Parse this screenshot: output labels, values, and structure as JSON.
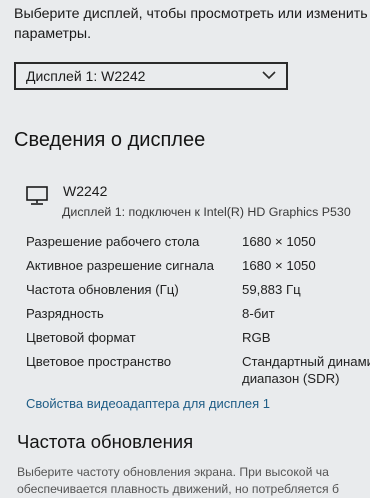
{
  "intro": {
    "line1": "Выберите дисплей, чтобы просмотреть или изменить е",
    "line2": "параметры."
  },
  "display_select": {
    "value": "Дисплей 1: W2242"
  },
  "details": {
    "title": "Сведения о дисплее",
    "monitor_name": "W2242",
    "monitor_desc": "Дисплей 1: подключен к Intel(R) HD Graphics P530",
    "rows": [
      {
        "label": "Разрешение рабочего стола",
        "value": "1680 × 1050"
      },
      {
        "label": "Активное разрешение сигнала",
        "value": "1680 × 1050"
      },
      {
        "label": "Частота обновления (Гц)",
        "value": "59,883 Гц"
      },
      {
        "label": "Разрядность",
        "value": "8-бит"
      },
      {
        "label": "Цветовой формат",
        "value": "RGB"
      },
      {
        "label": "Цветовое пространство",
        "value": "Стандартный динами",
        "value2": "диапазон (SDR)"
      }
    ],
    "adapter_link": "Свойства видеоадаптера для дисплея 1"
  },
  "refresh": {
    "title": "Частота обновления",
    "line1": "Выберите частоту обновления экрана. При высокой ча",
    "line2": "обеспечивается плавность движений, но потребляется б"
  },
  "icons": {
    "monitor": "monitor-icon",
    "chevron": "chevron-down-icon"
  },
  "colors": {
    "link": "#1f5d86",
    "background": "#e9ebed"
  }
}
